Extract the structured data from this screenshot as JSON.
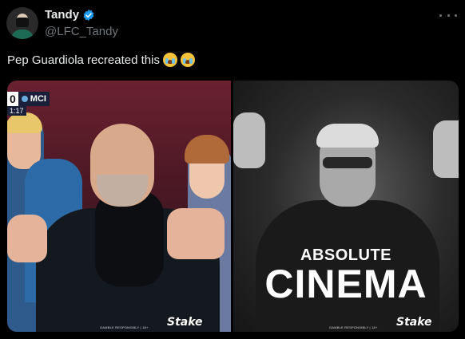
{
  "author": {
    "name": "Tandy",
    "handle": "@LFC_Tandy"
  },
  "tweet": {
    "text": "Pep Guardiola recreated this",
    "emojis": [
      "loudly-crying-face-emoji",
      "loudly-crying-face-emoji"
    ]
  },
  "media": {
    "left": {
      "score": "0",
      "team": "MCI",
      "clock": "1:17",
      "footer_note": "GAMBLE RESPONSIBLY | 18+",
      "brand": "Stake"
    },
    "right": {
      "caption_top": "ABSOLUTE",
      "caption_bottom": "CINEMA",
      "footer_note": "GAMBLE RESPONSIBLY | 18+",
      "brand": "Stake"
    }
  },
  "colors": {
    "background": "#000000",
    "verified": "#1d9bf0",
    "secondary_text": "#71767b",
    "primary_text": "#e7e9ea"
  }
}
